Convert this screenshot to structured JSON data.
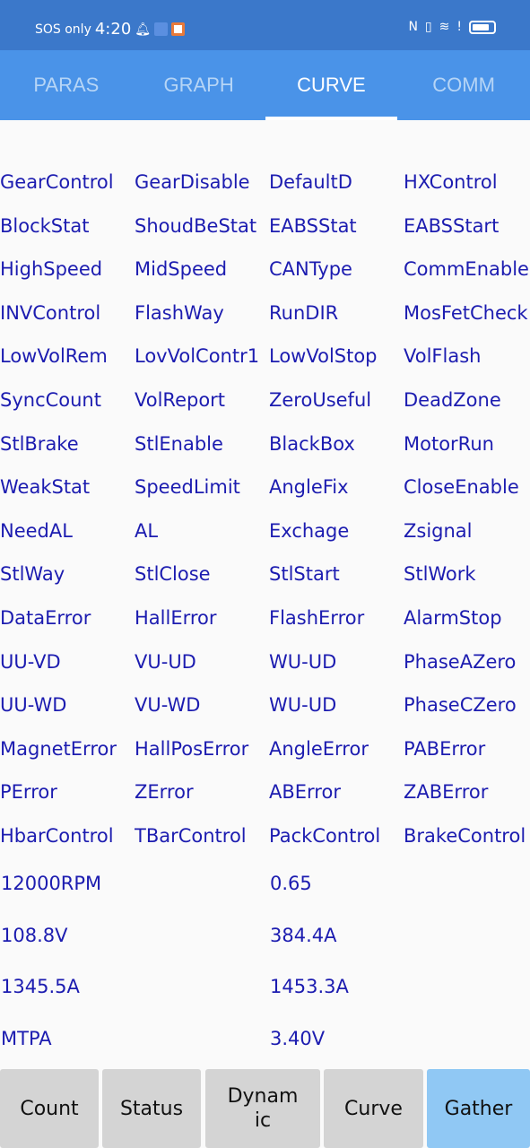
{
  "status_bar": {
    "carrier": "SOS only",
    "time": "4:20",
    "icons": [
      "bell-icon",
      "app-icon",
      "app-icon-2",
      "nfc-icon",
      "vibrate-icon",
      "wifi-icon",
      "alert-icon",
      "battery-icon"
    ]
  },
  "tabs": [
    {
      "label": "PARAS"
    },
    {
      "label": "GRAPH"
    },
    {
      "label": "CURVE",
      "active": true
    },
    {
      "label": "COMM"
    }
  ],
  "grid": [
    "GearControl",
    "GearDisable",
    "DefaultD",
    "HXControl",
    "BlockStat",
    "ShoudBeStat",
    "EABSStat",
    "EABSStart",
    "HighSpeed",
    "MidSpeed",
    "CANType",
    "CommEnable",
    "INVControl",
    "FlashWay",
    "RunDIR",
    "MosFetCheck",
    "LowVolRem",
    "LovVolContr1",
    "LowVolStop",
    "VolFlash",
    "SyncCount",
    "VolReport",
    "ZeroUseful",
    "DeadZone",
    "StlBrake",
    "StlEnable",
    "BlackBox",
    "MotorRun",
    "WeakStat",
    "SpeedLimit",
    "AngleFix",
    "CloseEnable",
    "NeedAL",
    "AL",
    "Exchage",
    "Zsignal",
    "StlWay",
    "StlClose",
    "StlStart",
    "StlWork",
    "DataError",
    "HallError",
    "FlashError",
    "AlarmStop",
    "UU-VD",
    "VU-UD",
    "WU-UD",
    "PhaseAZero",
    "UU-WD",
    "VU-WD",
    "WU-UD",
    "PhaseCZero",
    "MagnetError",
    "HallPosError",
    "AngleError",
    "PABError",
    "PError",
    "ZError",
    "ABError",
    "ZABError",
    "HbarControl",
    "TBarControl",
    "PackControl",
    "BrakeControl"
  ],
  "values": [
    "12000RPM",
    "0.65",
    "108.8V",
    "384.4A",
    "1345.5A",
    "1453.3A",
    "MTPA",
    "3.40V"
  ],
  "bottom_buttons": [
    {
      "label": "Count"
    },
    {
      "label": "Status"
    },
    {
      "label": "Dynamic"
    },
    {
      "label": "Curve"
    },
    {
      "label": "Gather",
      "active": true
    }
  ],
  "colors": {
    "status_bar": "#3b78ca",
    "tab_bar": "#4a93e8",
    "text": "#1c1cb0",
    "button": "#d4d4d4",
    "button_active": "#90c8f4"
  }
}
